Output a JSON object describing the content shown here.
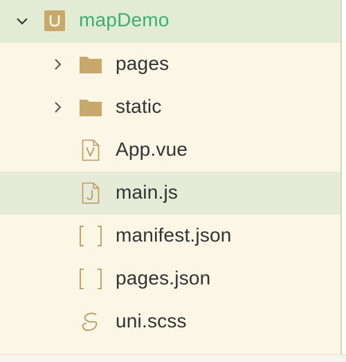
{
  "tree": {
    "root": {
      "label": "mapDemo",
      "icon": "uniapp-project-icon",
      "expanded": true
    },
    "folders": [
      {
        "label": "pages",
        "icon": "folder-icon",
        "expanded": false
      },
      {
        "label": "static",
        "icon": "folder-icon",
        "expanded": false
      }
    ],
    "files": [
      {
        "label": "App.vue",
        "icon": "vue-file-icon",
        "glyph": "V"
      },
      {
        "label": "main.js",
        "icon": "js-file-icon",
        "glyph": "J"
      },
      {
        "label": "manifest.json",
        "icon": "json-file-icon",
        "glyph": "[ ]"
      },
      {
        "label": "pages.json",
        "icon": "json-file-icon",
        "glyph": "[ ]"
      },
      {
        "label": "uni.scss",
        "icon": "scss-file-icon",
        "glyph": "S"
      }
    ]
  },
  "colors": {
    "panel_bg": "#fbf6e6",
    "selected_row": "#e2ecd5",
    "root_label": "#3fae74",
    "folder": "#c9a96b",
    "icon_stroke": "#b89a62",
    "text": "#333333"
  }
}
